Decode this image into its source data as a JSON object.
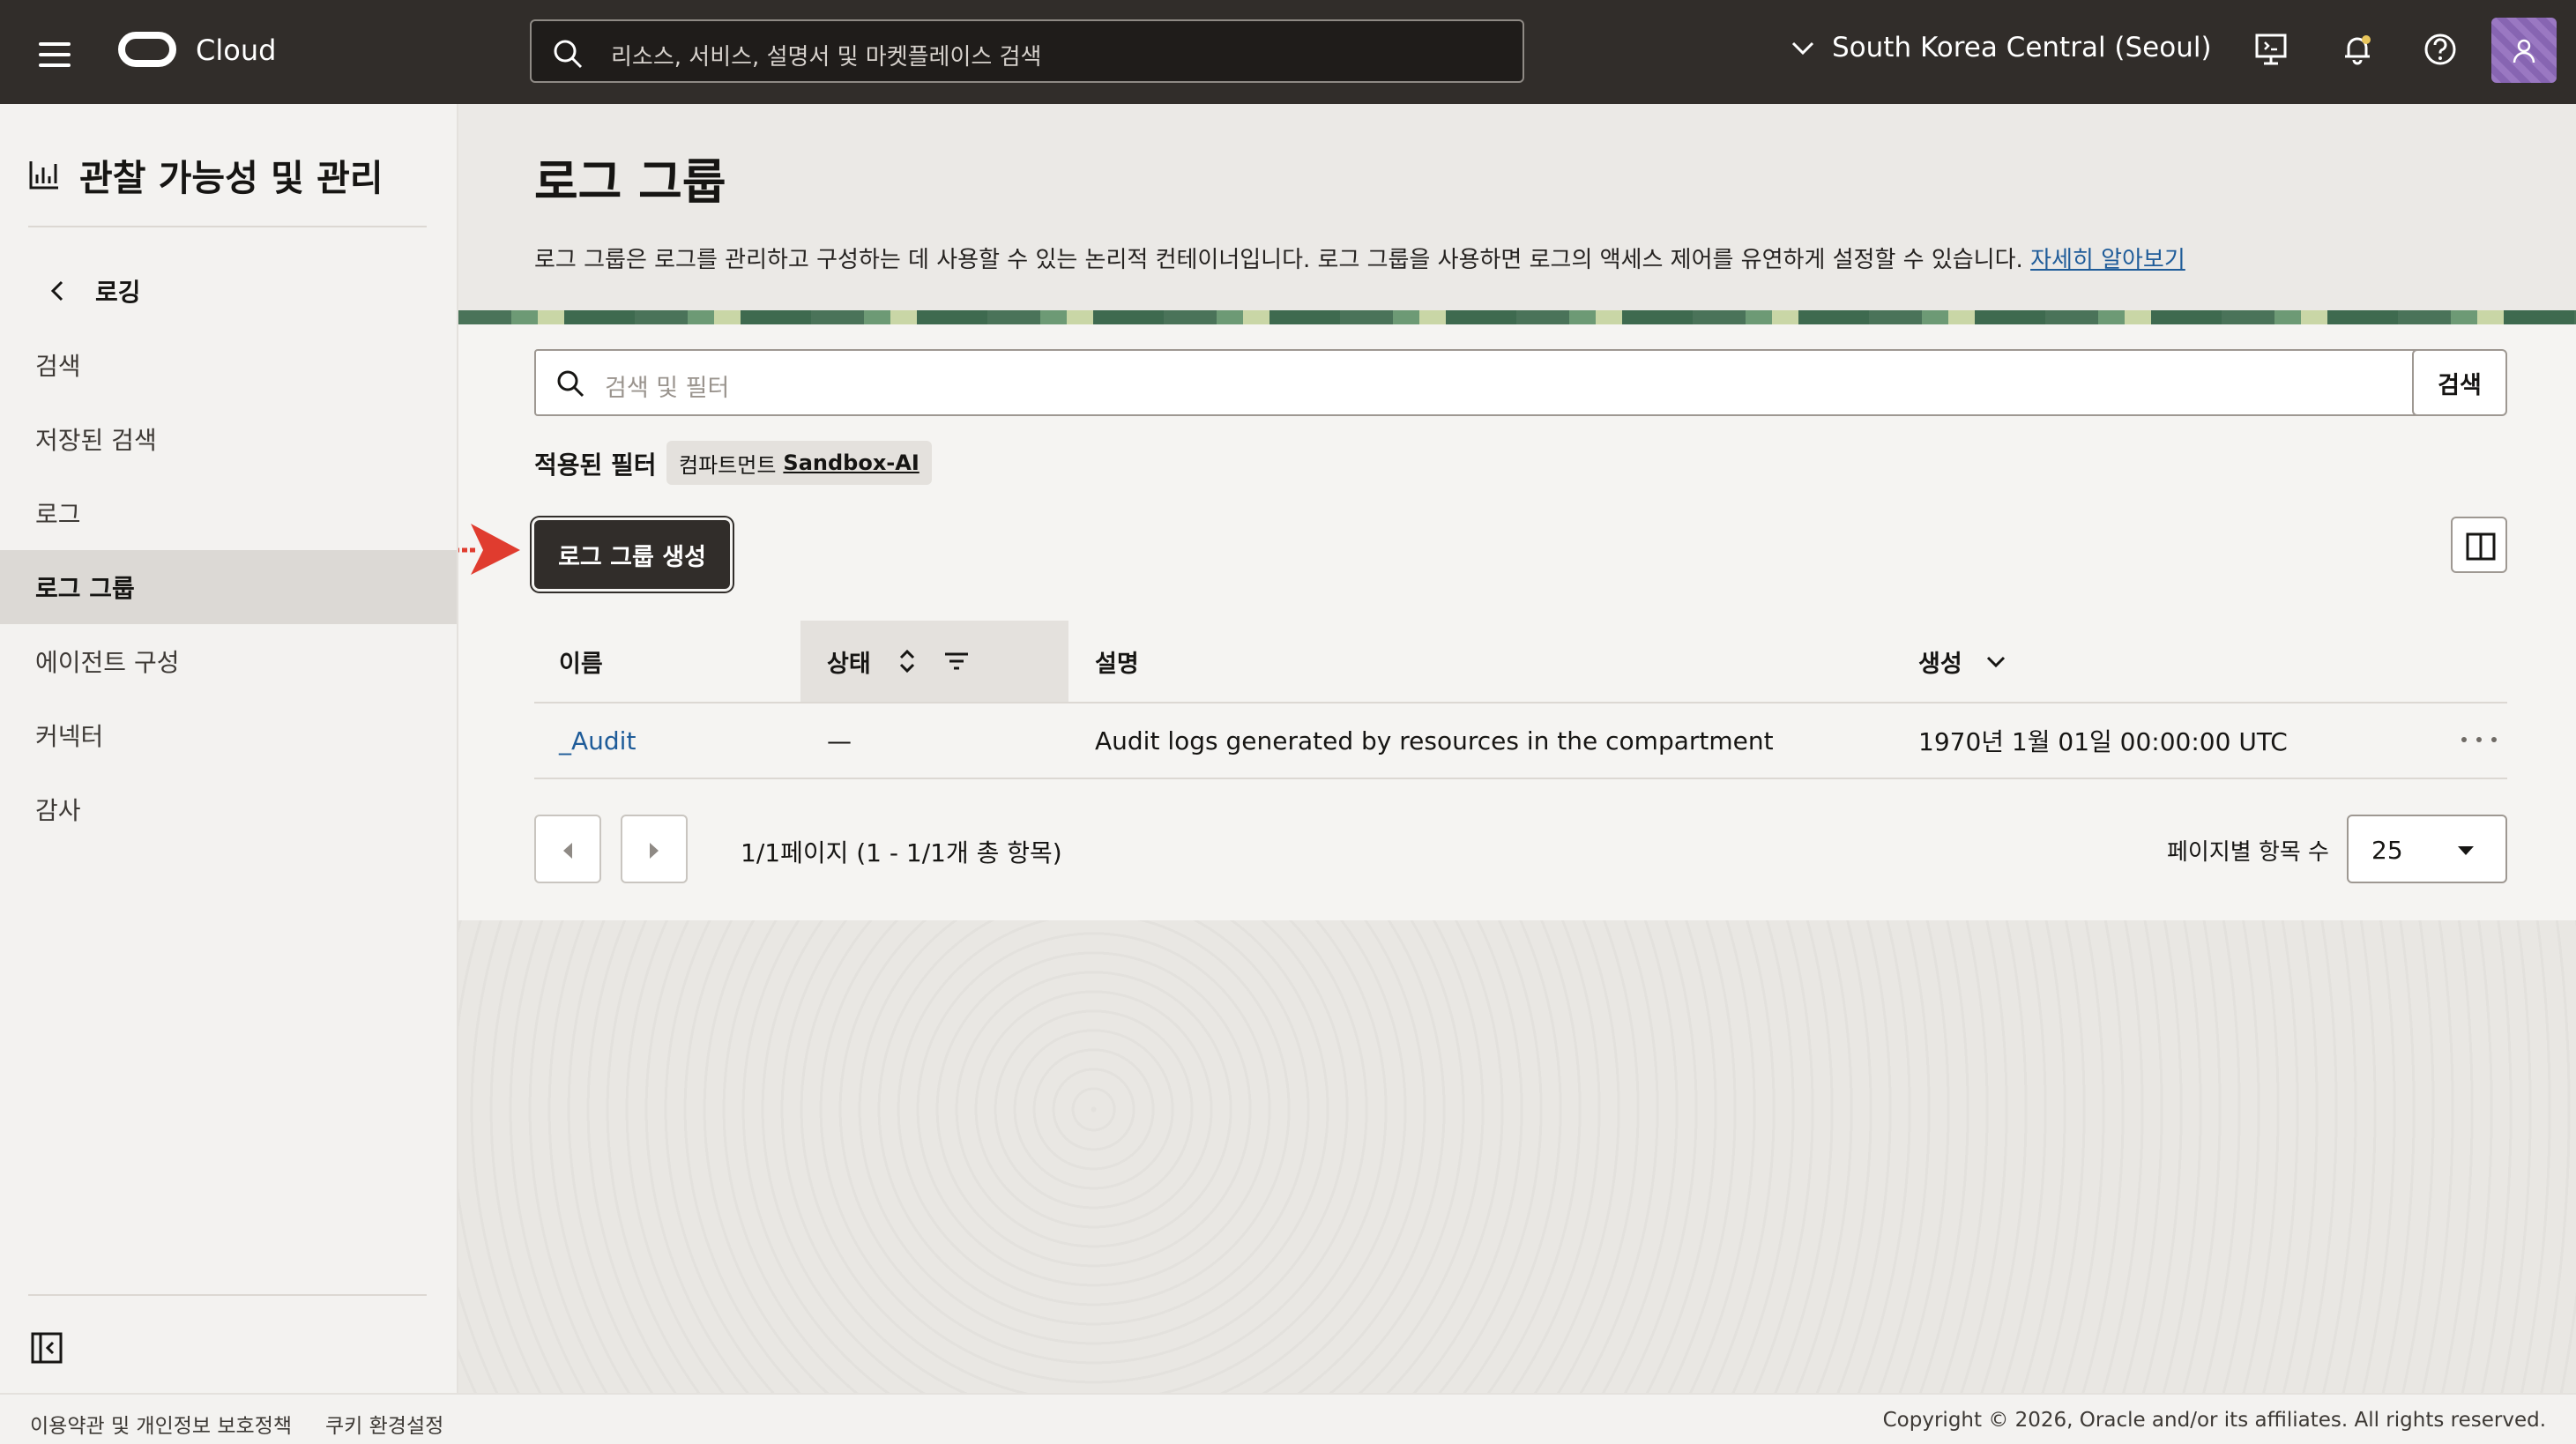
{
  "header": {
    "brand": "Cloud",
    "search_placeholder": "리소스, 서비스, 설명서 및 마켓플레이스 검색",
    "region": "South Korea Central (Seoul)"
  },
  "sidebar": {
    "title": "관찰 가능성 및 관리",
    "back_label": "로깅",
    "items": [
      {
        "label": "검색"
      },
      {
        "label": "저장된 검색"
      },
      {
        "label": "로그"
      },
      {
        "label": "로그 그룹"
      },
      {
        "label": "에이전트 구성"
      },
      {
        "label": "커넥터"
      },
      {
        "label": "감사"
      }
    ]
  },
  "page": {
    "title": "로그 그룹",
    "description": "로그 그룹은 로그를 관리하고 구성하는 데 사용할 수 있는 논리적 컨테이너입니다. 로그 그룹을 사용하면 로그의 액세스 제어를 유연하게 설정할 수 있습니다.",
    "learn_more": "자세히 알아보기"
  },
  "toolbar": {
    "search_placeholder": "검색 및 필터",
    "search_button": "검색",
    "filter_label": "적용된 필터",
    "filter_chip_key": "컴파트먼트",
    "filter_chip_value": "Sandbox-AI",
    "create_button": "로그 그룹 생성"
  },
  "table": {
    "headers": [
      "이름",
      "상태",
      "설명",
      "생성"
    ],
    "rows": [
      {
        "name": "_Audit",
        "status": "—",
        "description": "Audit logs generated by resources in the compartment",
        "created": "1970년 1월 01일 00:00:00 UTC"
      }
    ]
  },
  "pagination": {
    "summary": "1/1페이지 (1 - 1/1개 총 항목)",
    "page_size_label": "페이지별 항목 수",
    "page_size": "25"
  },
  "footer": {
    "terms": "이용약관 및 개인정보 보호정책",
    "cookies": "쿠키 환경설정",
    "copyright": "Copyright © 2026, Oracle and/or its affiliates. All rights reserved."
  },
  "colors": {
    "header_bg": "#312d2a",
    "accent_link": "#1f5c99",
    "annotation_arrow": "#e03c2f"
  }
}
